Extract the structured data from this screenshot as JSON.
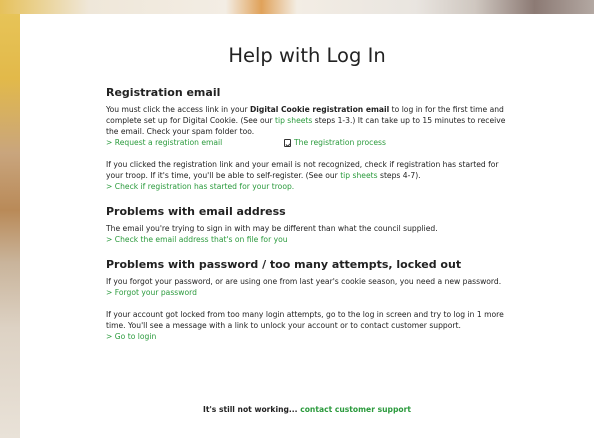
{
  "title": "Help with Log In",
  "sections": {
    "registration": {
      "heading": "Registration email",
      "p1": {
        "a": "You must click the access link in your ",
        "bold": "Digital Cookie registration email",
        "b": " to log in for the first time and complete set up for Digital Cookie. (See our ",
        "link": "tip sheets",
        "c": " steps 1-3.) It can take up to 15 minutes to receive the email. Check your spam folder too."
      },
      "link_request": "> Request a registration email",
      "link_process": "The registration process",
      "p2": {
        "a": "If you clicked the registration link and your email is not recognized, check if registration has started for your troop. If it's time, you'll be able to self-register. (See our ",
        "link": "tip sheets",
        "b": " steps 4-7)."
      },
      "link_check": "> Check if registration has started for your troop."
    },
    "email": {
      "heading": "Problems with email address",
      "p1": "The email you're trying to sign in with may be different than what the council supplied.",
      "link_check": "> Check the email address that's on file for you"
    },
    "password": {
      "heading": "Problems with password / too many attempts, locked out",
      "p1": "If you forgot your password, or are using one from last year's cookie season, you need a new password.",
      "link_forgot": "> Forgot your password",
      "p2": "If your account got locked from too many login attempts, go to the log in screen and try to log in 1 more time. You'll see a message with a link to unlock your account or to contact customer support.",
      "link_login": "> Go to login"
    }
  },
  "footer": {
    "text": "It's still not working... ",
    "link": "contact customer support"
  },
  "icons": {
    "process": "document-check-icon"
  },
  "colors": {
    "link": "#2a9a3c",
    "text": "#222222",
    "card": "#ffffff"
  }
}
